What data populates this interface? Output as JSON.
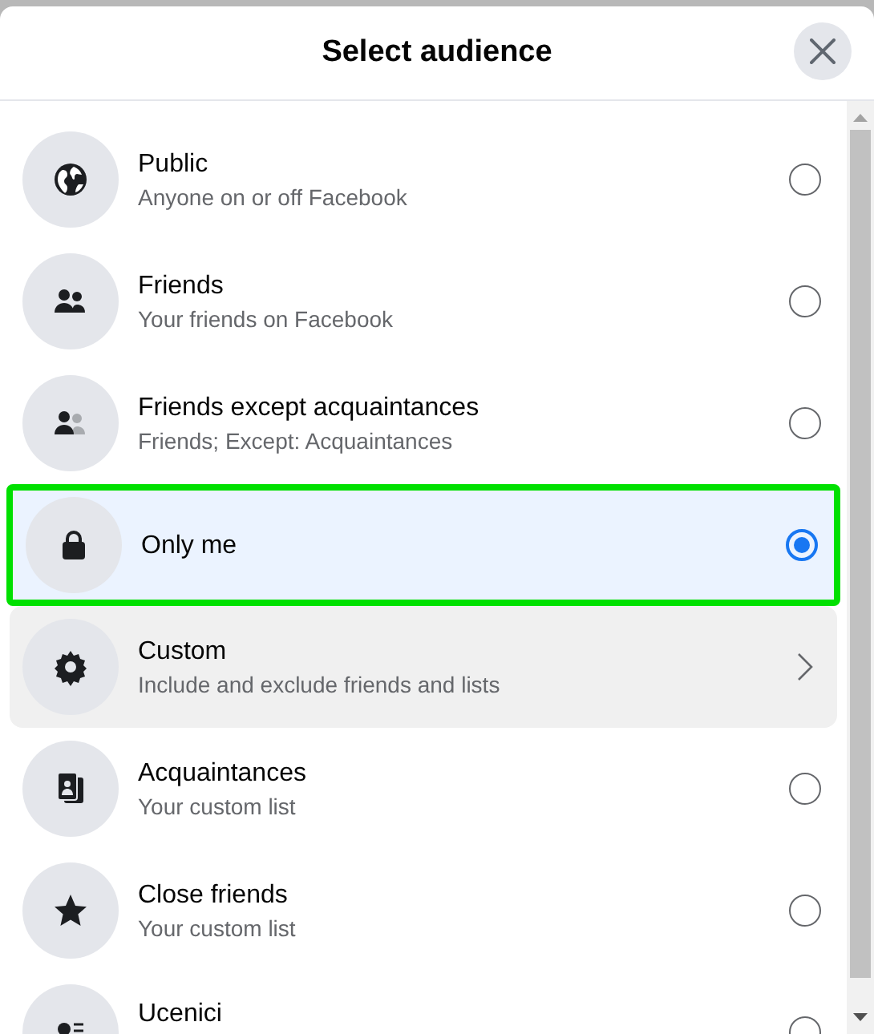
{
  "dialog": {
    "title": "Select audience"
  },
  "options": [
    {
      "kind": "radio",
      "title": "Public",
      "subtitle": "Anyone on or off Facebook",
      "selected": false,
      "highlighted": false
    },
    {
      "kind": "radio",
      "title": "Friends",
      "subtitle": "Your friends on Facebook",
      "selected": false,
      "highlighted": false
    },
    {
      "kind": "radio",
      "title": "Friends except acquaintances",
      "subtitle": "Friends; Except: Acquaintances",
      "selected": false,
      "highlighted": false
    },
    {
      "kind": "radio",
      "title": "Only me",
      "selected": true,
      "highlighted": false
    },
    {
      "kind": "submenu",
      "title": "Custom",
      "subtitle": "Include and exclude friends and lists",
      "highlighted": true
    },
    {
      "kind": "radio",
      "title": "Acquaintances",
      "subtitle": "Your custom list",
      "selected": false,
      "highlighted": false
    },
    {
      "kind": "radio",
      "title": "Close friends",
      "subtitle": "Your custom list",
      "selected": false,
      "highlighted": false
    },
    {
      "kind": "radio",
      "title": "Ucenici",
      "selected": false,
      "highlighted": false
    }
  ]
}
